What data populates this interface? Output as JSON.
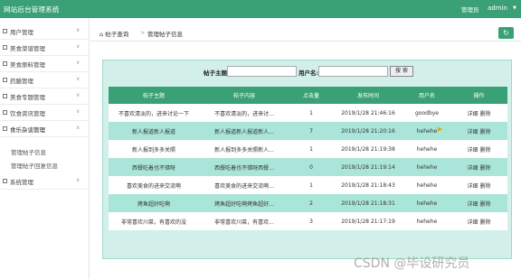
{
  "header": {
    "title": "网站后台管理系统",
    "role": "管理员",
    "username": "admin"
  },
  "sidebar": {
    "items": [
      {
        "label": "用户管理"
      },
      {
        "label": "美食菜谱管理"
      },
      {
        "label": "美食原料管理"
      },
      {
        "label": "药膳管理"
      },
      {
        "label": "美食专题管理"
      },
      {
        "label": "饮食资讯管理"
      },
      {
        "label": "食乐杂谈管理"
      },
      {
        "label": "系统管理"
      }
    ],
    "sub_items": [
      {
        "label": "管理帖子信息"
      },
      {
        "label": "管理帖子回复信息"
      }
    ]
  },
  "breadcrumb": {
    "home": "帖子查询",
    "separator": ">",
    "current": "管理帖子信息"
  },
  "search": {
    "label_subject": "帖子主题:",
    "value_subject": "",
    "label_user": "用户名:",
    "value_user": "",
    "button": "搜 索"
  },
  "table": {
    "columns": [
      "帖子主题",
      "帖子内容",
      "点击量",
      "发布时间",
      "用户名",
      "操作"
    ],
    "rows": [
      {
        "subject": "不喜欢清淡的，进来讨论一下",
        "content": "不喜欢清淡的，进来讨...",
        "clicks": "1",
        "time": "2019/1/28 21:46:16",
        "user": "goodbye",
        "detail": "详细",
        "delete": "删除"
      },
      {
        "subject": "新人报道新人报道",
        "content": "新人报道新人报道新人...",
        "clicks": "7",
        "time": "2019/1/28 21:20:16",
        "user": "hehehe",
        "detail": "详细",
        "delete": "删除"
      },
      {
        "subject": "新人报到多多关照",
        "content": "新人报到多多关照新人...",
        "clicks": "1",
        "time": "2019/1/28 21:19:38",
        "user": "hehehe",
        "detail": "详细",
        "delete": "删除"
      },
      {
        "subject": "西餐吃着也不错呀",
        "content": "西餐吃着也不错呀西餐...",
        "clicks": "0",
        "time": "2019/1/28 21:19:14",
        "user": "hehehe",
        "detail": "详细",
        "delete": "删除"
      },
      {
        "subject": "喜欢美食的进来交流啊",
        "content": "喜欢美食的进来交流啊...",
        "clicks": "1",
        "time": "2019/1/28 21:18:43",
        "user": "hehehe",
        "detail": "详细",
        "delete": "删除"
      },
      {
        "subject": "烤鱼超好吃啊",
        "content": "烤鱼超好吃啊烤鱼超好...",
        "clicks": "2",
        "time": "2019/1/28 21:18:31",
        "user": "hehehe",
        "detail": "详细",
        "delete": "删除"
      },
      {
        "subject": "非常喜欢川菜，有喜欢的没",
        "content": "非常喜欢川菜，有喜欢...",
        "clicks": "3",
        "time": "2019/1/28 21:17:19",
        "user": "hehehe",
        "detail": "详细",
        "delete": "删除"
      }
    ]
  },
  "watermark": "CSDN @毕设研究员",
  "colors": {
    "primary": "#3aa177",
    "panel": "#d2efe9",
    "row_alt": "#a9e5d8"
  }
}
